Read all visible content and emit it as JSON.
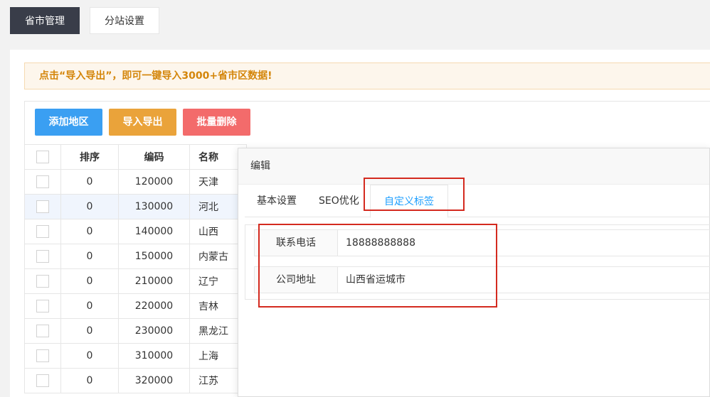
{
  "top_tabs": [
    {
      "label": "省市管理",
      "active": true
    },
    {
      "label": "分站设置",
      "active": false
    }
  ],
  "tip": "点击“导入导出”，即可一键导入3000+省市区数据!",
  "toolbar": {
    "add_label": "添加地区",
    "import_export_label": "导入导出",
    "batch_delete_label": "批量删除"
  },
  "table": {
    "headers": [
      "排序",
      "编码",
      "名称"
    ],
    "rows": [
      {
        "sort": "0",
        "code": "120000",
        "name": "天津"
      },
      {
        "sort": "0",
        "code": "130000",
        "name": "河北"
      },
      {
        "sort": "0",
        "code": "140000",
        "name": "山西"
      },
      {
        "sort": "0",
        "code": "150000",
        "name": "内蒙古"
      },
      {
        "sort": "0",
        "code": "210000",
        "name": "辽宁"
      },
      {
        "sort": "0",
        "code": "220000",
        "name": "吉林"
      },
      {
        "sort": "0",
        "code": "230000",
        "name": "黑龙江"
      },
      {
        "sort": "0",
        "code": "310000",
        "name": "上海"
      },
      {
        "sort": "0",
        "code": "320000",
        "name": "江苏"
      }
    ]
  },
  "dialog": {
    "title": "编辑",
    "tabs": [
      "基本设置",
      "SEO优化",
      "自定义标签"
    ],
    "fields": [
      {
        "label": "联系电话",
        "value": "18888888888"
      },
      {
        "label": "公司地址",
        "value": "山西省运城市"
      }
    ]
  },
  "colors": {
    "annotation_red": "#d42a1f",
    "active_tab_blue": "#1e9fff"
  }
}
